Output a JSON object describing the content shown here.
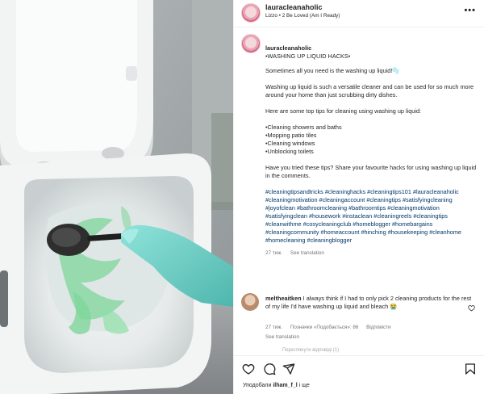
{
  "post": {
    "username": "lauracleanaholic",
    "song": "Lizzo • 2 Be Loved (Am I Ready)",
    "more_label": "•••"
  },
  "caption": {
    "username": "lauracleanaholic",
    "title": "•WASHING UP LIQUID HACKS•",
    "p1": "Sometimes all you need is the washing up liquid!🫧",
    "p2": "Washing up liquid is such a versatile cleaner and can be used for so much more around your home than just scrubbing dirty dishes.",
    "p3": "Here are some top tips for cleaning using washing up liquid:",
    "list": "•Cleaning showers and baths\n•Mopping patio tiles\n•Cleaning windows\n•Unblocking toilets",
    "p4": "Have you tried these tips? Share your favourite hacks for using washing up liquid in the comments.",
    "hashtags": "#cleaningtipsandtricks #cleaninghacks #cleaningtips101 #lauracleanaholic #cleaningmotivation #cleaningaccount #cleaningtips #satisfyingcleaning #joyofclean #bathroomcleaning #bathroomtips #cleaningmotivation #satisfyingclean #housework #instaclean #cleaningreels #cleaningtips #cleanwithme #cosycleaningclub #homeblogger #homebargains #cleaningcommunity #homeaccount #hinching #housekeeping #cleanhome #homecleaning #cleaningblogger",
    "time": "27 тиж.",
    "see_translation": "See translation"
  },
  "comment": {
    "username": "meltheaitken",
    "text": "I always think if I had to only pick 2 cleaning products for the rest of my life I'd have washing up liquid and bleach 😭",
    "time": "27 тиж.",
    "likes": "Позначки «Подобається»: 86",
    "reply": "Відповісти",
    "see_translation": "See translation",
    "view_replies": "Переглянути відповіді (1)"
  },
  "footer": {
    "liked_by_prefix": "Уподобали",
    "liked_by_user": "ilham_f_l",
    "liked_by_suffix": "і ще"
  },
  "icons": {
    "like": "heart-icon",
    "comment": "comment-icon",
    "share": "share-icon",
    "save": "bookmark-icon"
  },
  "colors": {
    "hashtag": "#00376b",
    "muted": "#737373",
    "glove": "#6fd1c9",
    "cleaner": "#7fd69a"
  }
}
